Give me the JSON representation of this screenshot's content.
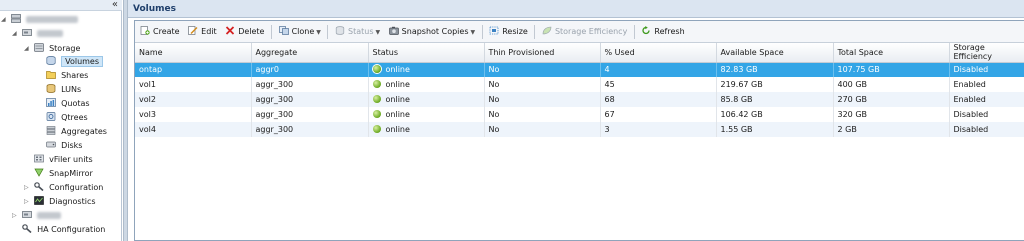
{
  "nav": {
    "collapse_glyph": "«",
    "nodes": {
      "storage": "Storage",
      "volumes": "Volumes",
      "shares": "Shares",
      "luns": "LUNs",
      "quotas": "Quotas",
      "qtrees": "Qtrees",
      "aggregates": "Aggregates",
      "disks": "Disks",
      "vfiler": "vFiler units",
      "snapmirror": "SnapMirror",
      "configuration": "Configuration",
      "diagnostics": "Diagnostics",
      "ha": "HA Configuration"
    }
  },
  "page_title": "Volumes",
  "toolbar": {
    "create": "Create",
    "edit": "Edit",
    "delete": "Delete",
    "clone": "Clone",
    "status": "Status",
    "snapshot": "Snapshot Copies",
    "resize": "Resize",
    "efficiency": "Storage Efficiency",
    "refresh": "Refresh"
  },
  "table": {
    "columns": [
      "Name",
      "Aggregate",
      "Status",
      "Thin Provisioned",
      "% Used",
      "Available Space",
      "Total Space",
      "Storage Efficiency"
    ],
    "rows": [
      [
        "ontap",
        "aggr0",
        "online",
        "No",
        "4",
        "82.83 GB",
        "107.75 GB",
        "Disabled"
      ],
      [
        "vol1",
        "aggr_300",
        "online",
        "No",
        "45",
        "219.67 GB",
        "400 GB",
        "Enabled"
      ],
      [
        "vol2",
        "aggr_300",
        "online",
        "No",
        "68",
        "85.8 GB",
        "270 GB",
        "Enabled"
      ],
      [
        "vol3",
        "aggr_300",
        "online",
        "No",
        "67",
        "106.42 GB",
        "320 GB",
        "Disabled"
      ],
      [
        "vol4",
        "aggr_300",
        "online",
        "No",
        "3",
        "1.55 GB",
        "2 GB",
        "Disabled"
      ]
    ]
  },
  "colors": {
    "selected_row": "#33a5e6",
    "status_online": "#6aa820",
    "title_text": "#1f3f6b"
  }
}
